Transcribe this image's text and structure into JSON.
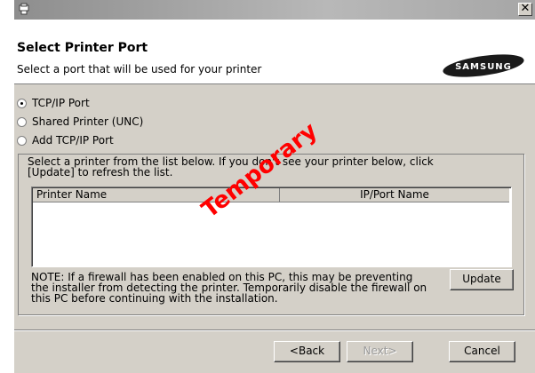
{
  "header": {
    "title": "Select Printer Port",
    "subtitle": "Select a port that will be used for your printer",
    "logo_text": "SAMSUNG"
  },
  "titlebar": {
    "close_glyph": "✕"
  },
  "ports": [
    {
      "label": "TCP/IP Port",
      "checked": true
    },
    {
      "label": "Shared Printer (UNC)",
      "checked": false
    },
    {
      "label": "Add TCP/IP Port",
      "checked": false
    }
  ],
  "printer_list": {
    "instructions_line1": "Select a printer from the list below. If you don't see your printer below, click",
    "instructions_line2": "[Update] to refresh the list.",
    "columns": [
      "Printer Name",
      "IP/Port Name"
    ],
    "rows": []
  },
  "note": {
    "line1": "NOTE: If a firewall has been enabled on this PC, this may be preventing",
    "line2": "the installer from detecting the printer. Temporarily disable the firewall on",
    "line3": "this PC before continuing with the installation."
  },
  "buttons": {
    "update": "Update",
    "back": "<Back",
    "next": "Next>",
    "cancel": "Cancel"
  },
  "watermark": "Temporary",
  "colors": {
    "watermark": "#ff0000",
    "dialog_bg": "#d4d0c8"
  }
}
